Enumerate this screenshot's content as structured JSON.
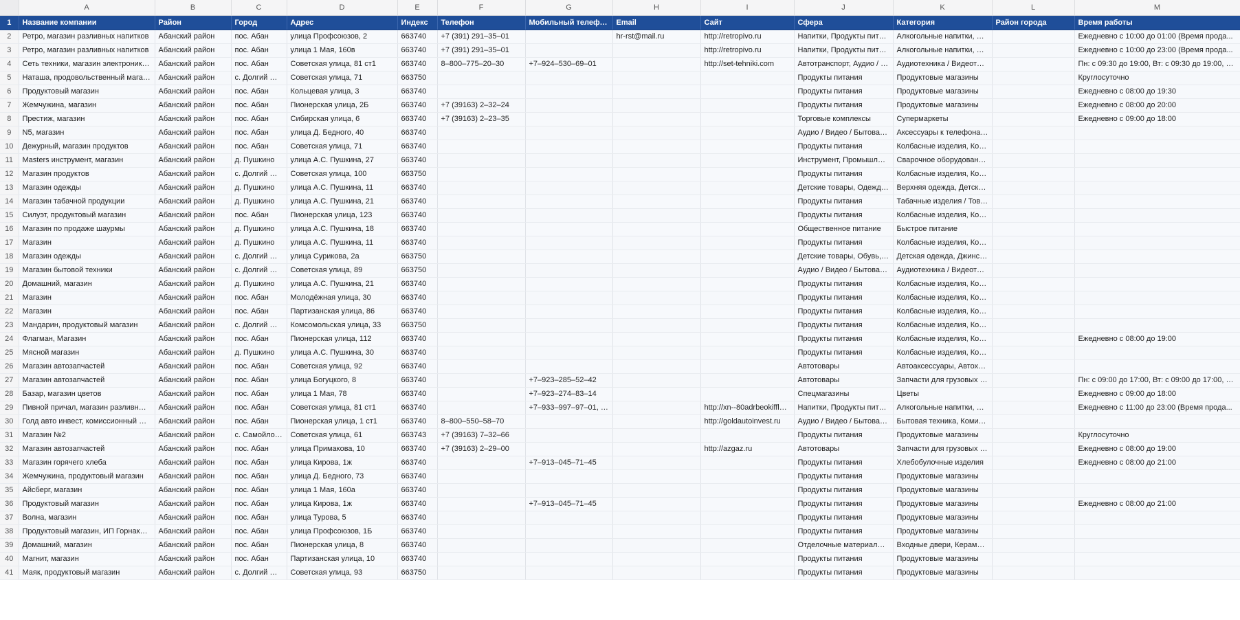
{
  "column_letters": [
    "A",
    "B",
    "C",
    "D",
    "E",
    "F",
    "G",
    "H",
    "I",
    "J",
    "K",
    "L",
    "M"
  ],
  "header_row_number": "1",
  "headers": [
    "Название компании",
    "Район",
    "Город",
    "Адрес",
    "Индекс",
    "Телефон",
    "Мобильный телефон",
    "Email",
    "Сайт",
    "Сфера",
    "Категория",
    "Район города",
    "Время работы"
  ],
  "rows": [
    [
      "2",
      "Ретро, магазин разливных напитков",
      "Абанский район",
      "пос. Абан",
      "улица Профсоюзов, 2",
      "663740",
      "+7 (391) 291–35–01",
      "",
      "hr-rst@mail.ru",
      "http://retropivo.ru",
      "Напитки, Продукты питания",
      "Алкогольные напитки, Без...",
      "",
      "Ежедневно с 10:00 до 01:00 (Время прода..."
    ],
    [
      "3",
      "Ретро, магазин разливных напитков",
      "Абанский район",
      "пос. Абан",
      "улица 1 Мая, 160в",
      "663740",
      "+7 (391) 291–35–01",
      "",
      "",
      "http://retropivo.ru",
      "Напитки, Продукты питания",
      "Алкогольные напитки, Без...",
      "",
      "Ежедневно с 10:00 до 23:00 (Время прода..."
    ],
    [
      "4",
      "Сеть техники, магазин электроники и ...",
      "Абанский район",
      "пос. Абан",
      "Советская улица, 81 ст1",
      "663740",
      "8–800–775–20–30",
      "+7–924–530–69–01",
      "",
      "http://set-tehniki.com",
      "Автотранспорт, Аудио / В...",
      "Аудиотехника / Видеотехн...",
      "",
      "Пн: с 09:30 до 19:00, Вт: с 09:30 до 19:00, С..."
    ],
    [
      "5",
      "Наташа, продовольственный магазин",
      "Абанский район",
      "с. Долгий Мост",
      "Советская улица, 71",
      "663750",
      "",
      "",
      "",
      "",
      "Продукты питания",
      "Продуктовые магазины",
      "",
      "Круглосуточно"
    ],
    [
      "6",
      "Продуктовый магазин",
      "Абанский район",
      "пос. Абан",
      "Кольцевая улица, 3",
      "663740",
      "",
      "",
      "",
      "",
      "Продукты питания",
      "Продуктовые магазины",
      "",
      "Ежедневно с 08:00 до 19:30"
    ],
    [
      "7",
      "Жемчужина, магазин",
      "Абанский район",
      "пос. Абан",
      "Пионерская улица, 2Б",
      "663740",
      "+7 (39163) 2–32–24",
      "",
      "",
      "",
      "Продукты питания",
      "Продуктовые магазины",
      "",
      "Ежедневно с 08:00 до 20:00"
    ],
    [
      "8",
      "Престиж, магазин",
      "Абанский район",
      "пос. Абан",
      "Сибирская улица, 6",
      "663740",
      "+7 (39163) 2–23–35",
      "",
      "",
      "",
      "Торговые комплексы",
      "Супермаркеты",
      "",
      "Ежедневно с 09:00 до 18:00"
    ],
    [
      "9",
      "N5, магазин",
      "Абанский район",
      "пос. Абан",
      "улица Д. Бедного, 40",
      "663740",
      "",
      "",
      "",
      "",
      "Аудио / Видео / Бытовая т...",
      "Аксессуары к телефонам, ...",
      "",
      ""
    ],
    [
      "10",
      "Дежурный, магазин продуктов",
      "Абанский район",
      "пос. Абан",
      "Советская улица, 71",
      "663740",
      "",
      "",
      "",
      "",
      "Продукты питания",
      "Колбасные изделия, Конд...",
      "",
      ""
    ],
    [
      "11",
      "Masters инструмент, магазин",
      "Абанский район",
      "д. Пушкино",
      "улица А.С. Пушкина, 27",
      "663740",
      "",
      "",
      "",
      "",
      "Инструмент, Промышленн...",
      "Сварочное оборудование,...",
      "",
      ""
    ],
    [
      "12",
      "Магазин продуктов",
      "Абанский район",
      "с. Долгий Мост",
      "Советская улица, 100",
      "663750",
      "",
      "",
      "",
      "",
      "Продукты питания",
      "Колбасные изделия, Конд...",
      "",
      ""
    ],
    [
      "13",
      "Магазин одежды",
      "Абанский район",
      "д. Пушкино",
      "улица А.С. Пушкина, 11",
      "663740",
      "",
      "",
      "",
      "",
      "Детские товары, Одежда / ...",
      "Верхняя одежда, Детская ...",
      "",
      ""
    ],
    [
      "14",
      "Магазин табачной продукции",
      "Абанский район",
      "д. Пушкино",
      "улица А.С. Пушкина, 21",
      "663740",
      "",
      "",
      "",
      "",
      "Продукты питания",
      "Табачные изделия / Товар...",
      "",
      ""
    ],
    [
      "15",
      "Силуэт, продуктовый магазин",
      "Абанский район",
      "пос. Абан",
      "Пионерская улица, 123",
      "663740",
      "",
      "",
      "",
      "",
      "Продукты питания",
      "Колбасные изделия, Конд...",
      "",
      ""
    ],
    [
      "16",
      "Магазин по продаже шаурмы",
      "Абанский район",
      "д. Пушкино",
      "улица А.С. Пушкина, 18",
      "663740",
      "",
      "",
      "",
      "",
      "Общественное питание",
      "Быстрое питание",
      "",
      ""
    ],
    [
      "17",
      "Магазин",
      "Абанский район",
      "д. Пушкино",
      "улица А.С. Пушкина, 11",
      "663740",
      "",
      "",
      "",
      "",
      "Продукты питания",
      "Колбасные изделия, Конд...",
      "",
      ""
    ],
    [
      "18",
      "Магазин одежды",
      "Абанский район",
      "с. Долгий Мост",
      "улица Сурикова, 2а",
      "663750",
      "",
      "",
      "",
      "",
      "Детские товары, Обувь, О...",
      "Детская одежда, Джинсов...",
      "",
      ""
    ],
    [
      "19",
      "Магазин бытовой техники",
      "Абанский район",
      "с. Долгий Мост",
      "Советская улица, 89",
      "663750",
      "",
      "",
      "",
      "",
      "Аудио / Видео / Бытовая т...",
      "Аудиотехника / Видеотехн...",
      "",
      ""
    ],
    [
      "20",
      "Домашний, магазин",
      "Абанский район",
      "д. Пушкино",
      "улица А.С. Пушкина, 21",
      "663740",
      "",
      "",
      "",
      "",
      "Продукты питания",
      "Колбасные изделия, Конд...",
      "",
      ""
    ],
    [
      "21",
      "Магазин",
      "Абанский район",
      "пос. Абан",
      "Молодёжная улица, 30",
      "663740",
      "",
      "",
      "",
      "",
      "Продукты питания",
      "Колбасные изделия, Конд...",
      "",
      ""
    ],
    [
      "22",
      "Магазин",
      "Абанский район",
      "пос. Абан",
      "Партизанская улица, 86",
      "663740",
      "",
      "",
      "",
      "",
      "Продукты питания",
      "Колбасные изделия, Конд...",
      "",
      ""
    ],
    [
      "23",
      "Мандарин, продуктовый магазин",
      "Абанский район",
      "с. Долгий Мост",
      "Комсомольская улица, 33",
      "663750",
      "",
      "",
      "",
      "",
      "Продукты питания",
      "Колбасные изделия, Конд...",
      "",
      ""
    ],
    [
      "24",
      "Флагман, Магазин",
      "Абанский район",
      "пос. Абан",
      "Пионерская улица, 112",
      "663740",
      "",
      "",
      "",
      "",
      "Продукты питания",
      "Колбасные изделия, Конд...",
      "",
      "Ежедневно с 08:00 до 19:00"
    ],
    [
      "25",
      "Мясной магазин",
      "Абанский район",
      "д. Пушкино",
      "улица А.С. Пушкина, 30",
      "663740",
      "",
      "",
      "",
      "",
      "Продукты питания",
      "Колбасные изделия, Конд...",
      "",
      ""
    ],
    [
      "26",
      "Магазин автозапчастей",
      "Абанский район",
      "пос. Абан",
      "Советская улица, 92",
      "663740",
      "",
      "",
      "",
      "",
      "Автотовары",
      "Автоаксессуары, Автохими...",
      "",
      ""
    ],
    [
      "27",
      "Магазин автозапчастей",
      "Абанский район",
      "пос. Абан",
      "улица Богуцкого, 8",
      "663740",
      "",
      "+7–923–285–52–42",
      "",
      "",
      "Автотовары",
      "Запчасти для грузовых авт...",
      "",
      "Пн: с 09:00 до 17:00, Вт: с 09:00 до 17:00, С..."
    ],
    [
      "28",
      "Базар, магазин цветов",
      "Абанский район",
      "пос. Абан",
      "улица 1 Мая, 78",
      "663740",
      "",
      "+7–923–274–83–14",
      "",
      "",
      "Спецмагазины",
      "Цветы",
      "",
      "Ежедневно с 09:00 до 18:00"
    ],
    [
      "29",
      "Пивной причал, магазин разливных н...",
      "Абанский район",
      "пос. Абан",
      "Советская улица, 81 ст1",
      "663740",
      "",
      "+7–933–997–97–01, +7...",
      "",
      "http://xn--80adrbeokiffl9f...",
      "Напитки, Продукты питания",
      "Алкогольные напитки, Без...",
      "",
      "Ежедневно с 11:00 до 23:00 (Время прода..."
    ],
    [
      "30",
      "Голд авто инвест, комиссионный маг...",
      "Абанский район",
      "пос. Абан",
      "Пионерская улица, 1 ст1",
      "663740",
      "8–800–550–58–70",
      "",
      "",
      "http://goldautoinvest.ru",
      "Аудио / Видео / Бытовая т...",
      "Бытовая техника, Комисси...",
      "",
      ""
    ],
    [
      "31",
      "Магазин №2",
      "Абанский район",
      "с. Самойловка",
      "Советская улица, 61",
      "663743",
      "+7 (39163) 7–32–66",
      "",
      "",
      "",
      "Продукты питания",
      "Продуктовые магазины",
      "",
      "Круглосуточно"
    ],
    [
      "32",
      "Магазин автозапчастей",
      "Абанский район",
      "пос. Абан",
      "улица Примакова, 10",
      "663740",
      "+7 (39163) 2–29–00",
      "",
      "",
      "http://azgaz.ru",
      "Автотовары",
      "Запчасти для грузовых авт...",
      "",
      "Ежедневно с 08:00 до 19:00"
    ],
    [
      "33",
      "Магазин горячего хлеба",
      "Абанский район",
      "пос. Абан",
      "улица Кирова, 1ж",
      "663740",
      "",
      "+7–913–045–71–45",
      "",
      "",
      "Продукты питания",
      "Хлебобулочные изделия",
      "",
      "Ежедневно с 08:00 до 21:00"
    ],
    [
      "34",
      "Жемчужина, продуктовый магазин",
      "Абанский район",
      "пос. Абан",
      "улица Д. Бедного, 73",
      "663740",
      "",
      "",
      "",
      "",
      "Продукты питания",
      "Продуктовые магазины",
      "",
      ""
    ],
    [
      "35",
      "Айсберг, магазин",
      "Абанский район",
      "пос. Абан",
      "улица 1 Мая, 160а",
      "663740",
      "",
      "",
      "",
      "",
      "Продукты питания",
      "Продуктовые магазины",
      "",
      ""
    ],
    [
      "36",
      "Продуктовый магазин",
      "Абанский район",
      "пос. Абан",
      "улица Кирова, 1ж",
      "663740",
      "",
      "+7–913–045–71–45",
      "",
      "",
      "Продукты питания",
      "Продуктовые магазины",
      "",
      "Ежедневно с 08:00 до 21:00"
    ],
    [
      "37",
      "Волна, магазин",
      "Абанский район",
      "пос. Абан",
      "улица Турова, 5",
      "663740",
      "",
      "",
      "",
      "",
      "Продукты питания",
      "Продуктовые магазины",
      "",
      ""
    ],
    [
      "38",
      "Продуктовый магазин, ИП Горнакова...",
      "Абанский район",
      "пос. Абан",
      "улица Профсоюзов, 1Б",
      "663740",
      "",
      "",
      "",
      "",
      "Продукты питания",
      "Продуктовые магазины",
      "",
      ""
    ],
    [
      "39",
      "Домашний, магазин",
      "Абанский район",
      "пос. Абан",
      "Пионерская улица, 8",
      "663740",
      "",
      "",
      "",
      "",
      "Отделочные материалы, С...",
      "Входные двери, Керамиче...",
      "",
      ""
    ],
    [
      "40",
      "Магнит, магазин",
      "Абанский район",
      "пос. Абан",
      "Партизанская улица, 10",
      "663740",
      "",
      "",
      "",
      "",
      "Продукты питания",
      "Продуктовые магазины",
      "",
      ""
    ],
    [
      "41",
      "Маяк, продуктовый магазин",
      "Абанский район",
      "с. Долгий Мост",
      "Советская улица, 93",
      "663750",
      "",
      "",
      "",
      "",
      "Продукты питания",
      "Продуктовые магазины",
      "",
      ""
    ]
  ]
}
